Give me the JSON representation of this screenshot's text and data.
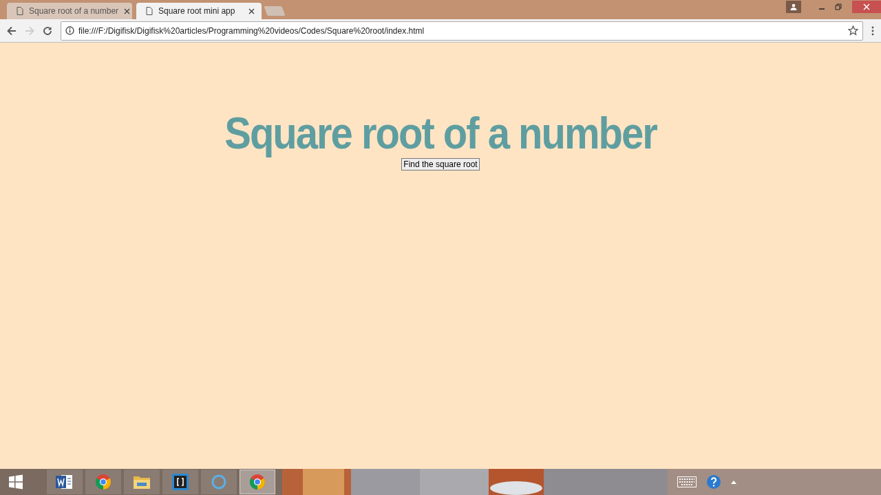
{
  "tabs": [
    {
      "title": "Square root of a number",
      "selected": false
    },
    {
      "title": "Square root mini app",
      "selected": true
    }
  ],
  "address_bar": {
    "url": "file:///F:/Digifisk/Digifisk%20articles/Programming%20videos/Codes/Square%20root/index.html"
  },
  "page": {
    "heading": "Square root of a number",
    "button": "Find the square root"
  },
  "taskbar": {
    "apps": [
      {
        "kind": "word",
        "selected": false
      },
      {
        "kind": "chrome",
        "selected": false
      },
      {
        "kind": "explorer",
        "selected": false
      },
      {
        "kind": "brackets",
        "selected": false
      },
      {
        "kind": "cortana",
        "selected": false
      },
      {
        "kind": "chrome",
        "selected": true
      }
    ]
  }
}
